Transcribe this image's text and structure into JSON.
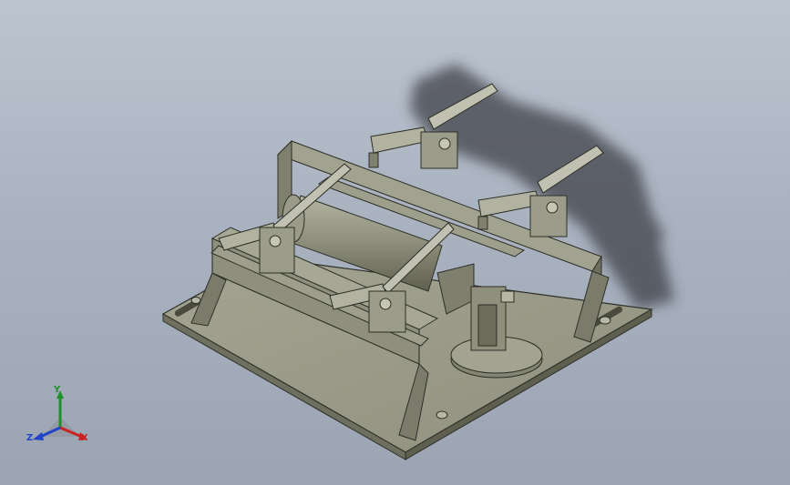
{
  "viewport": {
    "background_top": "#bcc4cf",
    "background_bottom": "#9aa4b3",
    "model_color": "#8a8b78",
    "shadow_color": "#3f434a"
  },
  "view_triad": {
    "x_label": "X",
    "y_label": "Y",
    "z_label": "Z",
    "x_color": "#c82222",
    "y_color": "#1f8f2c",
    "z_color": "#2244c8"
  },
  "model": {
    "toggle_clamp_count": 4,
    "icon": "cad-assembly-fixture"
  }
}
